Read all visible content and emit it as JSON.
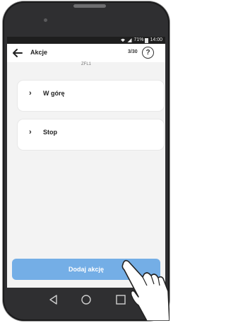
{
  "status_bar": {
    "battery_percent": "71%",
    "time": "14:00"
  },
  "appbar": {
    "title": "Akcje",
    "counter": "3/30",
    "help_symbol": "?"
  },
  "device_label": "ZFL1",
  "actions": [
    {
      "label": "W górę",
      "chevron": "›"
    },
    {
      "label": "Stop",
      "chevron": "›"
    }
  ],
  "add_button_label": "Dodaj akcję",
  "colors": {
    "primary": "#74aee6",
    "background": "#f3f3f3",
    "status_bar": "#1e1e1e"
  },
  "icons": [
    "back-arrow-icon",
    "help-icon",
    "wifi-icon",
    "signal-icon",
    "battery-icon",
    "nav-back-icon",
    "nav-home-icon",
    "nav-recents-icon"
  ]
}
